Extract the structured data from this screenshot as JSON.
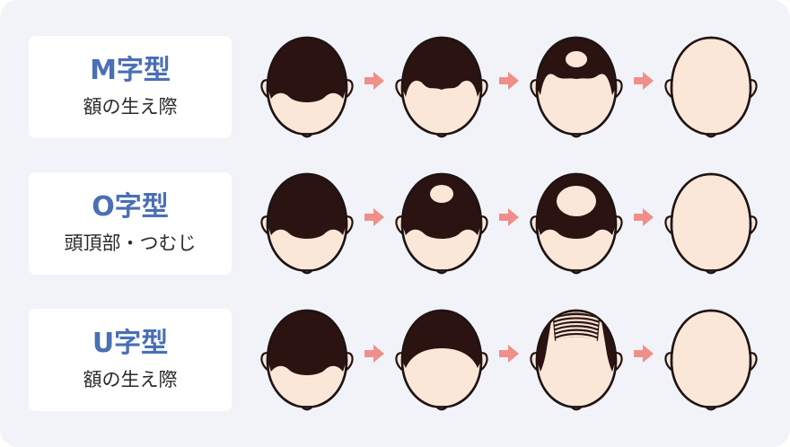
{
  "types": [
    {
      "title": "M字型",
      "subtitle": "額の生え際",
      "stages": [
        "m1",
        "m2",
        "m3",
        "bald"
      ]
    },
    {
      "title": "O字型",
      "subtitle": "頭頂部・つむじ",
      "stages": [
        "o1",
        "o2",
        "o3",
        "bald"
      ]
    },
    {
      "title": "U字型",
      "subtitle": "額の生え際",
      "stages": [
        "u1",
        "u2",
        "u3",
        "bald"
      ]
    }
  ],
  "colors": {
    "background": "#f2f3f8",
    "card": "#ffffff",
    "title_accent": "#4a6fb5",
    "hair": "#2b1311",
    "skin": "#fbe7d8",
    "arrow": "#ef8f8a",
    "outline": "#1f1413"
  },
  "icons": {
    "arrow": "arrow-right-icon",
    "head": "head-top-view-icon"
  }
}
